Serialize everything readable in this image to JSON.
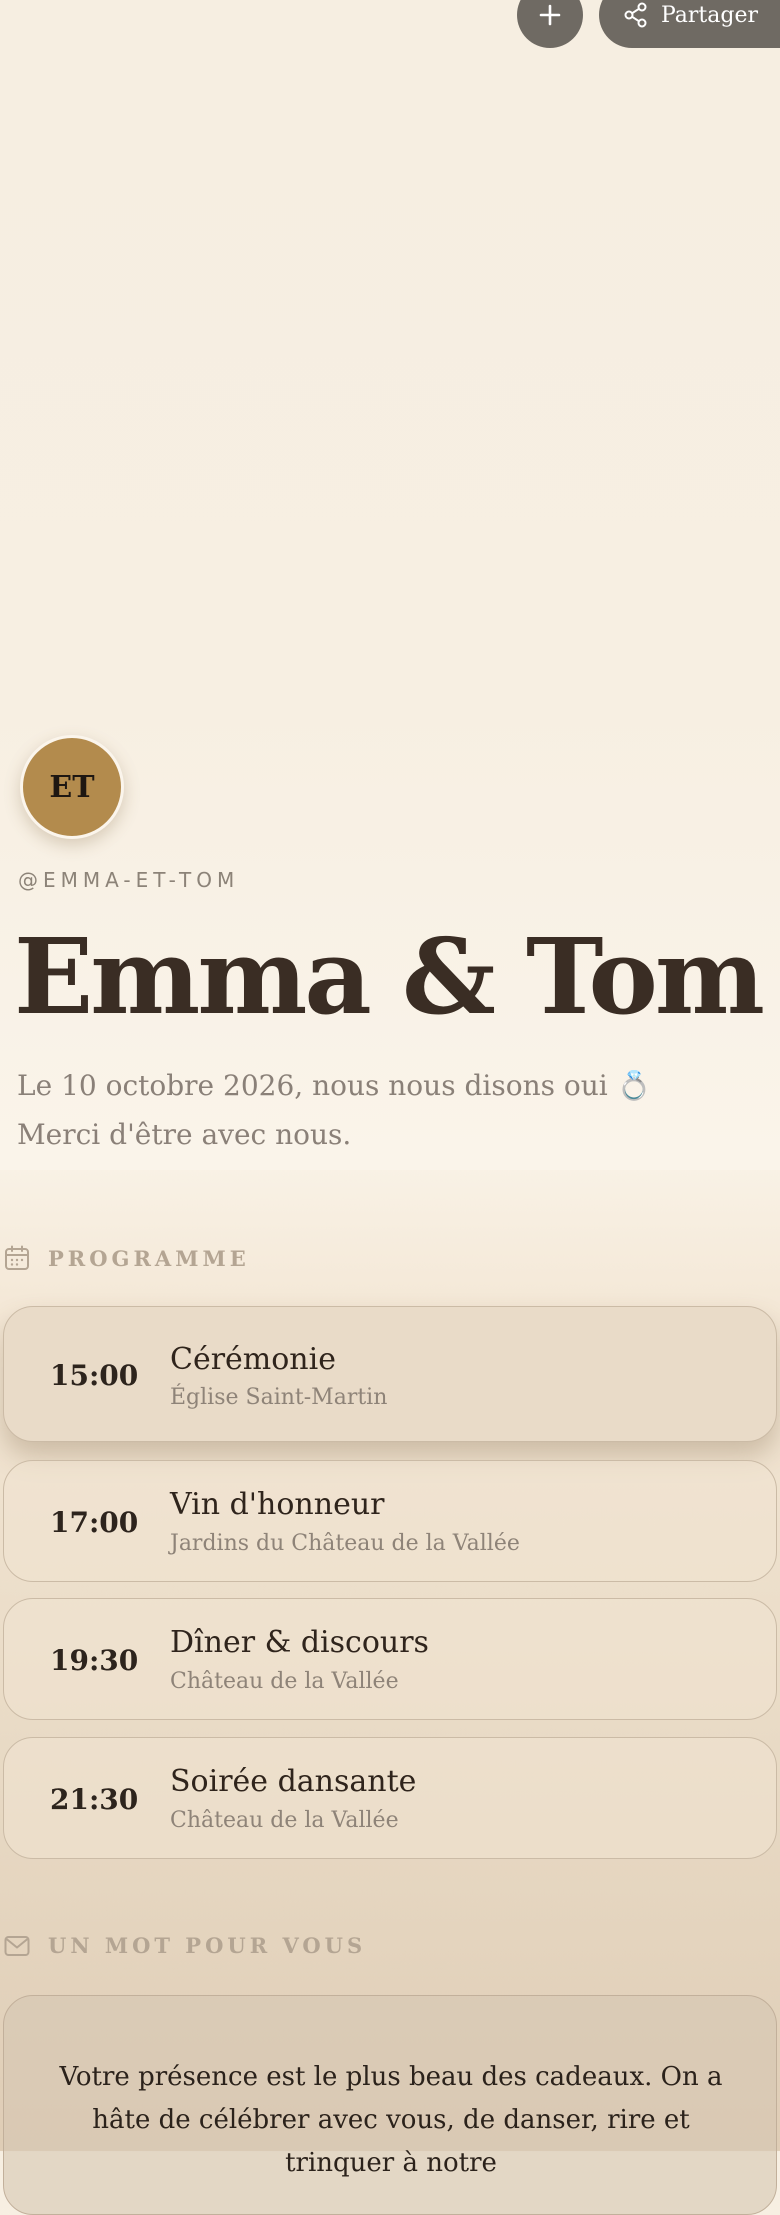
{
  "header": {
    "add_icon": "plus-icon",
    "share_icon": "share-icon",
    "share_label": "Partager"
  },
  "profile": {
    "initials": "ET",
    "avatar_color": "#b38b4d",
    "handle": "@EMMA-ET-TOM",
    "title": "Emma & Tom",
    "subtitle": "Le 10 octobre 2026, nous nous disons oui 💍 Merci d'être avec nous."
  },
  "programme": {
    "heading": "PROGRAMME",
    "icon": "calendar-icon",
    "events": [
      {
        "time": "15:00",
        "title": "Cérémonie",
        "place": "Église Saint-Martin"
      },
      {
        "time": "17:00",
        "title": "Vin d'honneur",
        "place": "Jardins du Château de la Vallée"
      },
      {
        "time": "19:30",
        "title": "Dîner & discours",
        "place": "Château de la Vallée"
      },
      {
        "time": "21:30",
        "title": "Soirée dansante",
        "place": "Château de la Vallée"
      }
    ]
  },
  "message": {
    "heading": "UN MOT POUR VOUS",
    "icon": "mail-icon",
    "text": "Votre présence est le plus beau des cadeaux. On a hâte de célébrer avec vous, de danser, rire et trinquer à notre"
  }
}
